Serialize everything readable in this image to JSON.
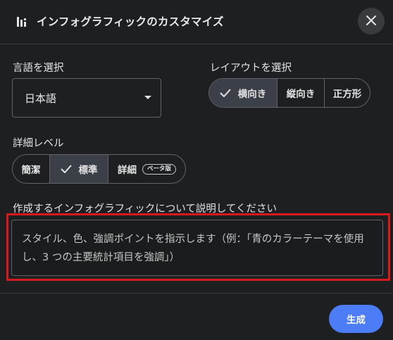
{
  "dialog": {
    "title": "インフォグラフィックのカスタマイズ",
    "icon": "bar-chart-icon",
    "close_icon": "close-icon"
  },
  "language": {
    "label": "言語を選択",
    "selected": "日本語"
  },
  "layout": {
    "label": "レイアウトを選択",
    "options": [
      "横向き",
      "縦向き",
      "正方形"
    ],
    "selected": "横向き"
  },
  "detail": {
    "label": "詳細レベル",
    "options": [
      "簡潔",
      "標準",
      "詳細"
    ],
    "selected": "標準",
    "beta_badge": "ベータ版"
  },
  "description": {
    "label": "作成するインフォグラフィックについて説明してください",
    "placeholder": "スタイル、色、強調ポイントを指示します（例：「青のカラーテーマを使用し、3 つの主要統計項目を強調」）"
  },
  "actions": {
    "generate": "生成"
  },
  "colors": {
    "primary": "#4c7cf6",
    "highlight_box": "#d71920",
    "selected_segment": "#3b3f47"
  }
}
